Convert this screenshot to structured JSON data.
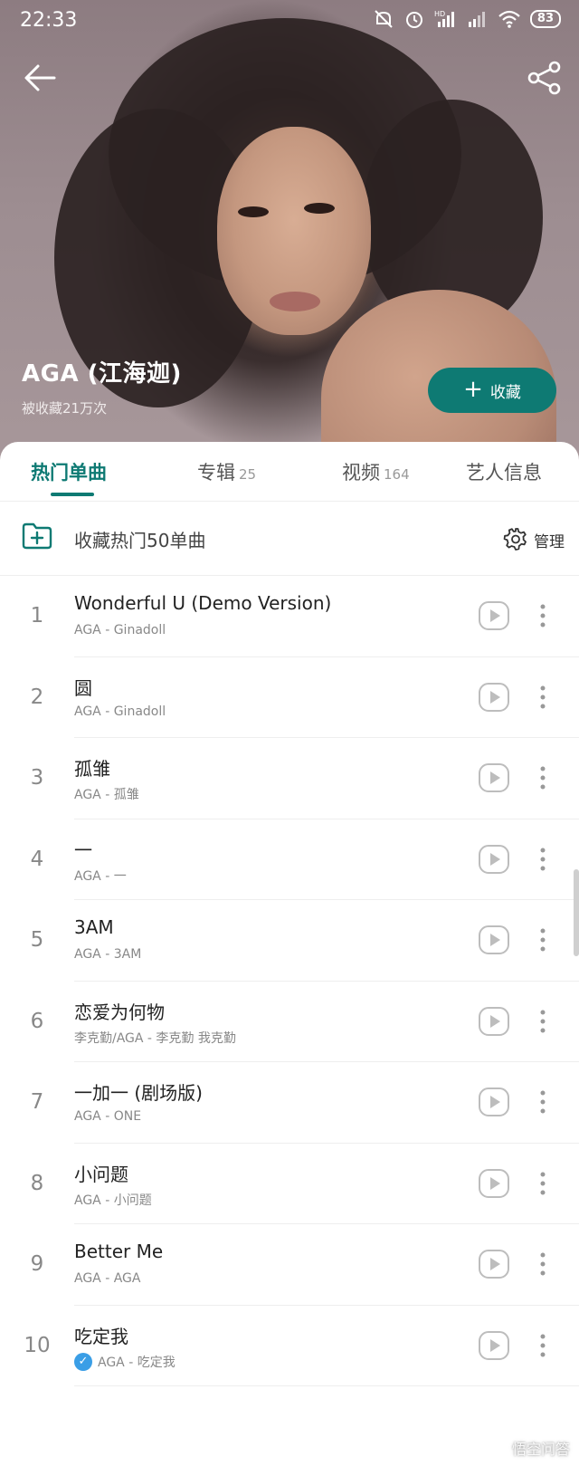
{
  "status_bar": {
    "time": "22:33",
    "battery": "83",
    "icons": [
      "mute-icon",
      "alarm-icon",
      "hd-signal-icon",
      "signal-icon",
      "wifi-icon",
      "battery-icon"
    ]
  },
  "header": {
    "back_icon": "arrow-left-icon",
    "share_icon": "share-icon"
  },
  "artist": {
    "name": "AGA (江海迦)",
    "favorites": "被收藏21万次",
    "follow_label": "收藏"
  },
  "tabs": [
    {
      "label": "热门单曲",
      "count": ""
    },
    {
      "label": "专辑",
      "count": "25"
    },
    {
      "label": "视频",
      "count": "164"
    },
    {
      "label": "艺人信息",
      "count": ""
    }
  ],
  "collect_bar": {
    "label": "收藏热门50单曲",
    "manage_label": "管理"
  },
  "songs": [
    {
      "num": "1",
      "title": "Wonderful U (Demo Version)",
      "sub": "AGA - Ginadoll"
    },
    {
      "num": "2",
      "title": "圆",
      "sub": "AGA - Ginadoll"
    },
    {
      "num": "3",
      "title": "孤雏",
      "sub": "AGA - 孤雏"
    },
    {
      "num": "4",
      "title": "一",
      "sub": "AGA - 一"
    },
    {
      "num": "5",
      "title": "3AM",
      "sub": "AGA - 3AM"
    },
    {
      "num": "6",
      "title": "恋爱为何物",
      "sub": "李克勤/AGA - 李克勤 我克勤"
    },
    {
      "num": "7",
      "title": "一加一 (剧场版)",
      "sub": "AGA - ONE"
    },
    {
      "num": "8",
      "title": "小问题",
      "sub": "AGA - 小问题"
    },
    {
      "num": "9",
      "title": "Better Me",
      "sub": "AGA - AGA"
    },
    {
      "num": "10",
      "title": "吃定我",
      "sub": "AGA - 吃定我",
      "verified": true
    }
  ],
  "watermark": "悟空问答",
  "colors": {
    "accent": "#0e7a73",
    "verified": "#3a9ee6"
  }
}
